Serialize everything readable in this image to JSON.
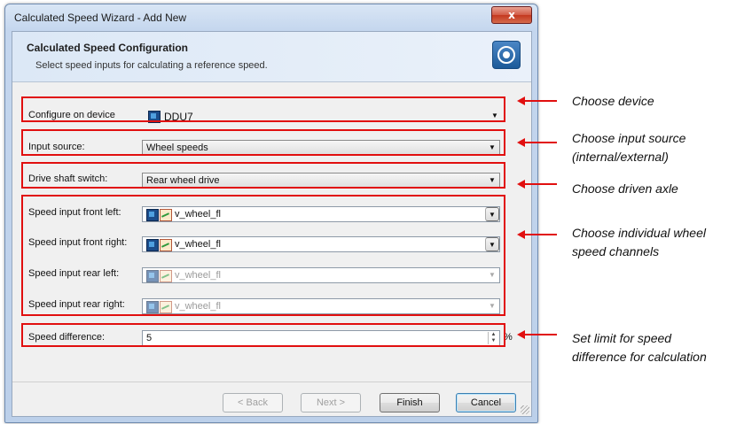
{
  "window": {
    "title": "Calculated Speed Wizard - Add New",
    "close_glyph": "x"
  },
  "header": {
    "title": "Calculated Speed Configuration",
    "subtitle": "Select speed inputs for calculating a reference speed.",
    "icon": "wheel-icon"
  },
  "form": {
    "device": {
      "label": "Configure on device",
      "value": "DDU7"
    },
    "input_source": {
      "label": "Input source:",
      "value": "Wheel speeds"
    },
    "drive_shaft": {
      "label": "Drive shaft switch:",
      "value": "Rear wheel drive"
    },
    "speed_inputs": [
      {
        "label": "Speed input front left:",
        "value": "v_wheel_fl",
        "enabled": true
      },
      {
        "label": "Speed input front right:",
        "value": "v_wheel_fl",
        "enabled": true
      },
      {
        "label": "Speed input rear left:",
        "value": "v_wheel_fl",
        "enabled": false
      },
      {
        "label": "Speed input rear right:",
        "value": "v_wheel_fl",
        "enabled": false
      }
    ],
    "speed_difference": {
      "label": "Speed difference:",
      "value": "5",
      "unit": "%"
    }
  },
  "buttons": {
    "back": "< Back",
    "next": "Next >",
    "finish": "Finish",
    "cancel": "Cancel"
  },
  "annotations": {
    "device": "Choose device",
    "input_source_line1": "Choose input source",
    "input_source_line2": "(internal/external)",
    "driven_axle": "Choose driven axle",
    "wheel_channels_line1": "Choose individual wheel",
    "wheel_channels_line2": "speed channels",
    "limit_line1": "Set limit for speed",
    "limit_line2": "difference for calculation"
  },
  "colors": {
    "annotation_red": "#e10f0f",
    "header_bg": "#dce8f6"
  }
}
